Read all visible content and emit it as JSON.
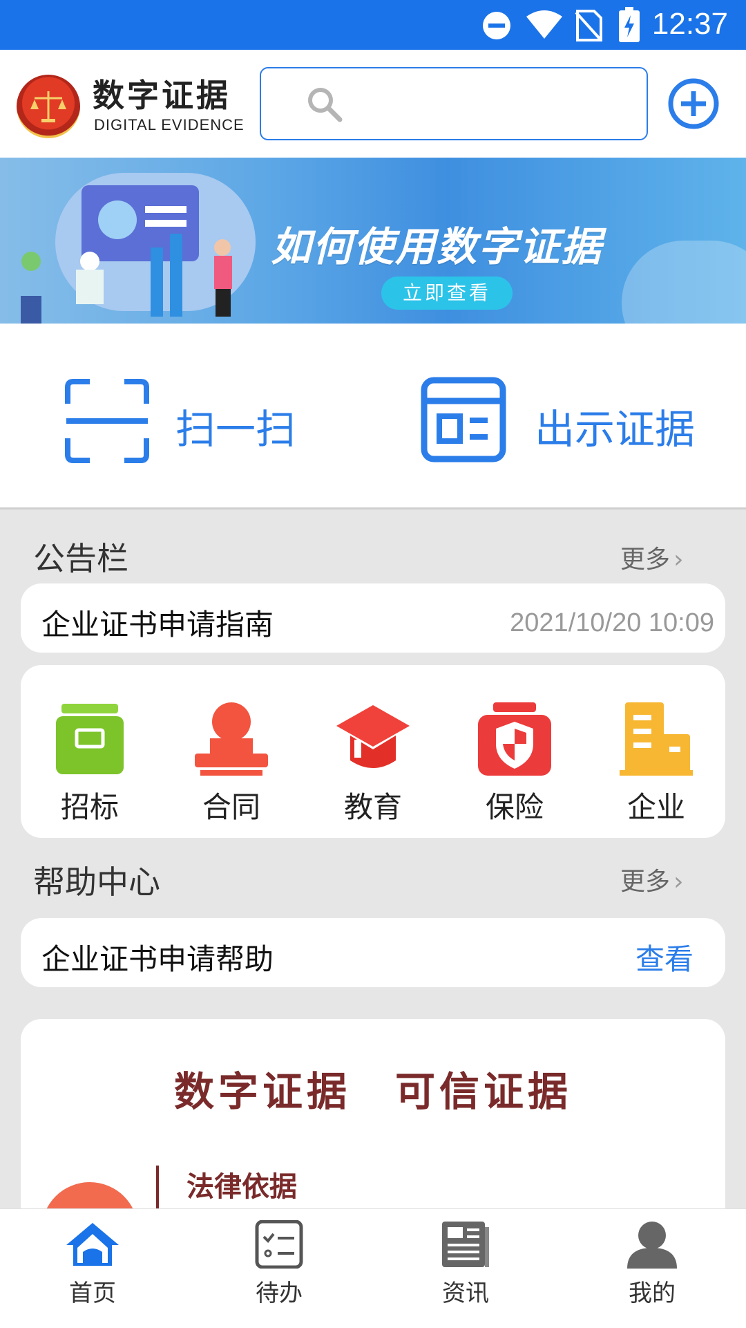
{
  "status_bar": {
    "time": "12:37"
  },
  "header": {
    "logo_cn": "数字证据",
    "logo_en": "DIGITAL EVIDENCE",
    "search_placeholder": ""
  },
  "banner": {
    "title": "如何使用数字证据",
    "button": "立即查看"
  },
  "quick_actions": [
    {
      "label": "扫一扫",
      "icon": "scan-icon"
    },
    {
      "label": "出示证据",
      "icon": "evidence-card-icon"
    }
  ],
  "notice": {
    "title": "公告栏",
    "more": "更多",
    "item_text": "企业证书申请指南",
    "item_time": "2021/10/20 10:09"
  },
  "categories": [
    {
      "label": "招标",
      "icon": "tender-box-icon",
      "color": "#7cc42a"
    },
    {
      "label": "合同",
      "icon": "stamp-icon",
      "color": "#f2543f"
    },
    {
      "label": "教育",
      "icon": "graduation-cap-icon",
      "color": "#f0423a"
    },
    {
      "label": "保险",
      "icon": "shield-icon",
      "color": "#ec3b3b"
    },
    {
      "label": "企业",
      "icon": "building-icon",
      "color": "#f7b733"
    }
  ],
  "help": {
    "title": "帮助中心",
    "more": "更多",
    "item_text": "企业证书申请帮助",
    "item_action": "查看"
  },
  "promo": {
    "title": "数字证据　可信证据",
    "subtitle": "法律依据"
  },
  "nav": [
    {
      "label": "首页",
      "icon": "home-icon",
      "active": true
    },
    {
      "label": "待办",
      "icon": "todo-list-icon",
      "active": false
    },
    {
      "label": "资讯",
      "icon": "news-icon",
      "active": false
    },
    {
      "label": "我的",
      "icon": "profile-icon",
      "active": false
    }
  ],
  "colors": {
    "primary": "#1a73e8",
    "accent": "#2b7de9",
    "promo": "#7a2a2a"
  }
}
